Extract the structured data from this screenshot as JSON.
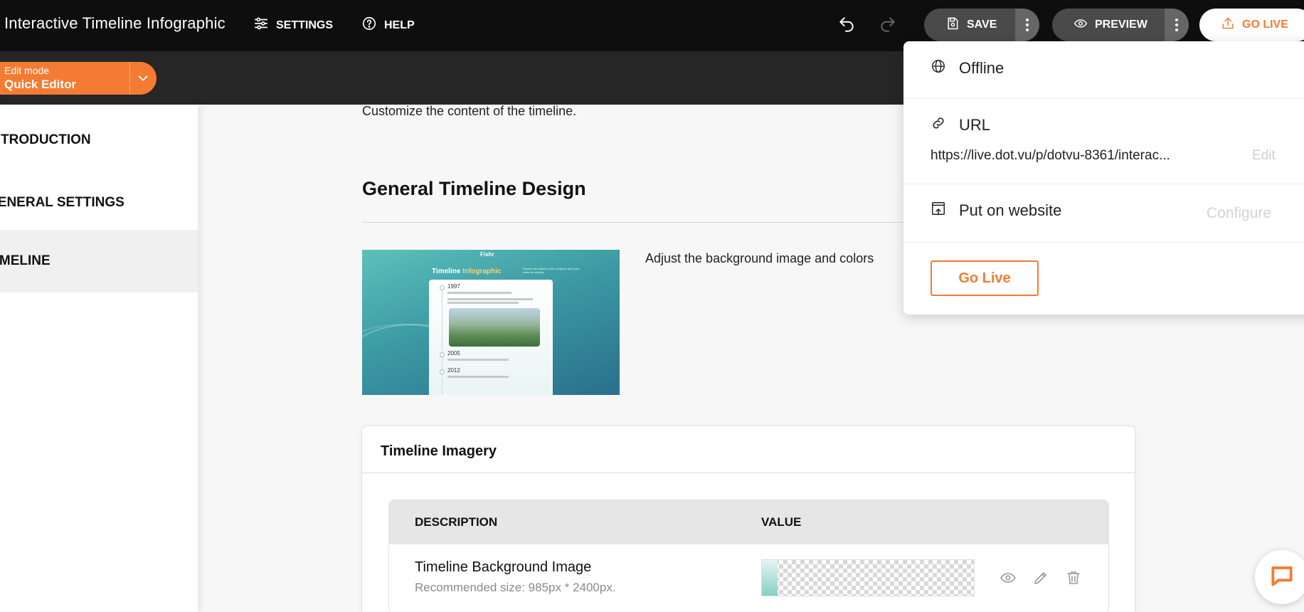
{
  "app": {
    "title": "Interactive Timeline Infographic"
  },
  "toolbar": {
    "settings_label": "SETTINGS",
    "help_label": "HELP",
    "save_label": "SAVE",
    "preview_label": "PREVIEW",
    "go_live_label": "GO LIVE"
  },
  "edit_mode": {
    "caption": "Edit mode",
    "value": "Quick Editor"
  },
  "sidebar": {
    "items": [
      {
        "label": "INTRODUCTION",
        "active": false
      },
      {
        "label": "GENERAL SETTINGS",
        "active": false
      },
      {
        "label": "TIMELINE",
        "active": true
      }
    ]
  },
  "main": {
    "intro_text": "Customize the content of the timeline.",
    "section_title": "General Timeline Design",
    "adjust_text": "Adjust the background image and colors"
  },
  "thumbnail": {
    "logo": "Fishr",
    "title_plain": "Timeline ",
    "title_highlight": "Infographic",
    "subtitle": "Explore the history of the company and more notes by clicking",
    "years": [
      "1997",
      "2005",
      "2012"
    ]
  },
  "imagery": {
    "title": "Timeline Imagery",
    "columns": [
      "DESCRIPTION",
      "VALUE"
    ],
    "rows": [
      {
        "name": "Timeline Background Image",
        "description": "Recommended size: 985px * 2400px."
      }
    ]
  },
  "dropdown": {
    "status": "Offline",
    "url_label": "URL",
    "url_value": "https://live.dot.vu/p/dotvu-8361/interac...",
    "edit_label": "Edit",
    "put_on_website_label": "Put on website",
    "configure_label": "Configure",
    "go_live_button": "Go Live"
  },
  "colors": {
    "accent": "#f47b33",
    "topbar": "#0e0e0e",
    "subbar": "#262626"
  },
  "icons": [
    "settings-sliders-icon",
    "help-circle-icon",
    "undo-icon",
    "redo-icon",
    "save-icon",
    "more-vertical-icon",
    "eye-icon",
    "upload-icon",
    "chevron-down-icon",
    "globe-icon",
    "link-icon",
    "embed-icon",
    "pencil-icon",
    "trash-icon",
    "chat-icon"
  ]
}
